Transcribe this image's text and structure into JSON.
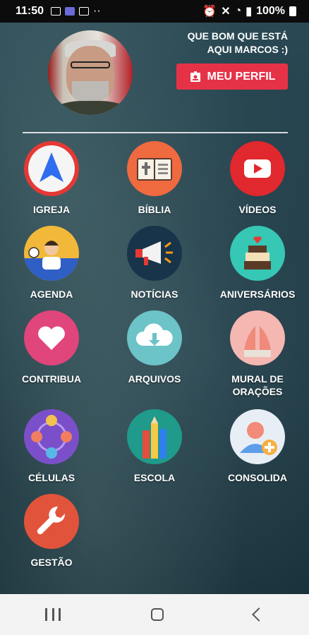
{
  "status": {
    "time": "11:50",
    "battery": "100%"
  },
  "header": {
    "greeting_line1": "QUE BOM QUE ESTÁ",
    "greeting_line2": "AQUI MARCOS :)",
    "profile_button": "MEU PERFIL"
  },
  "menu": [
    {
      "label": "IGREJA",
      "icon": "navigation-arrow-icon"
    },
    {
      "label": "BÍBLIA",
      "icon": "bible-book-icon"
    },
    {
      "label": "VÍDEOS",
      "icon": "play-video-icon"
    },
    {
      "label": "AGENDA",
      "icon": "calendar-person-icon"
    },
    {
      "label": "NOTÍCIAS",
      "icon": "megaphone-icon"
    },
    {
      "label": "ANIVERSÁRIOS",
      "icon": "birthday-cake-icon"
    },
    {
      "label": "CONTRIBUA",
      "icon": "heart-icon"
    },
    {
      "label": "ARQUIVOS",
      "icon": "cloud-download-icon"
    },
    {
      "label_line1": "MURAL DE",
      "label_line2": "ORAÇÕES",
      "icon": "praying-hands-icon"
    },
    {
      "label": "CÉLULAS",
      "icon": "group-people-icon"
    },
    {
      "label": "ESCOLA",
      "icon": "pencils-icon"
    },
    {
      "label": "CONSOLIDA",
      "icon": "add-user-icon"
    },
    {
      "label": "GESTÃO",
      "icon": "wrench-icon"
    }
  ],
  "colors": {
    "accent": "#e63247",
    "nav_bg": "#f3f3f3"
  }
}
